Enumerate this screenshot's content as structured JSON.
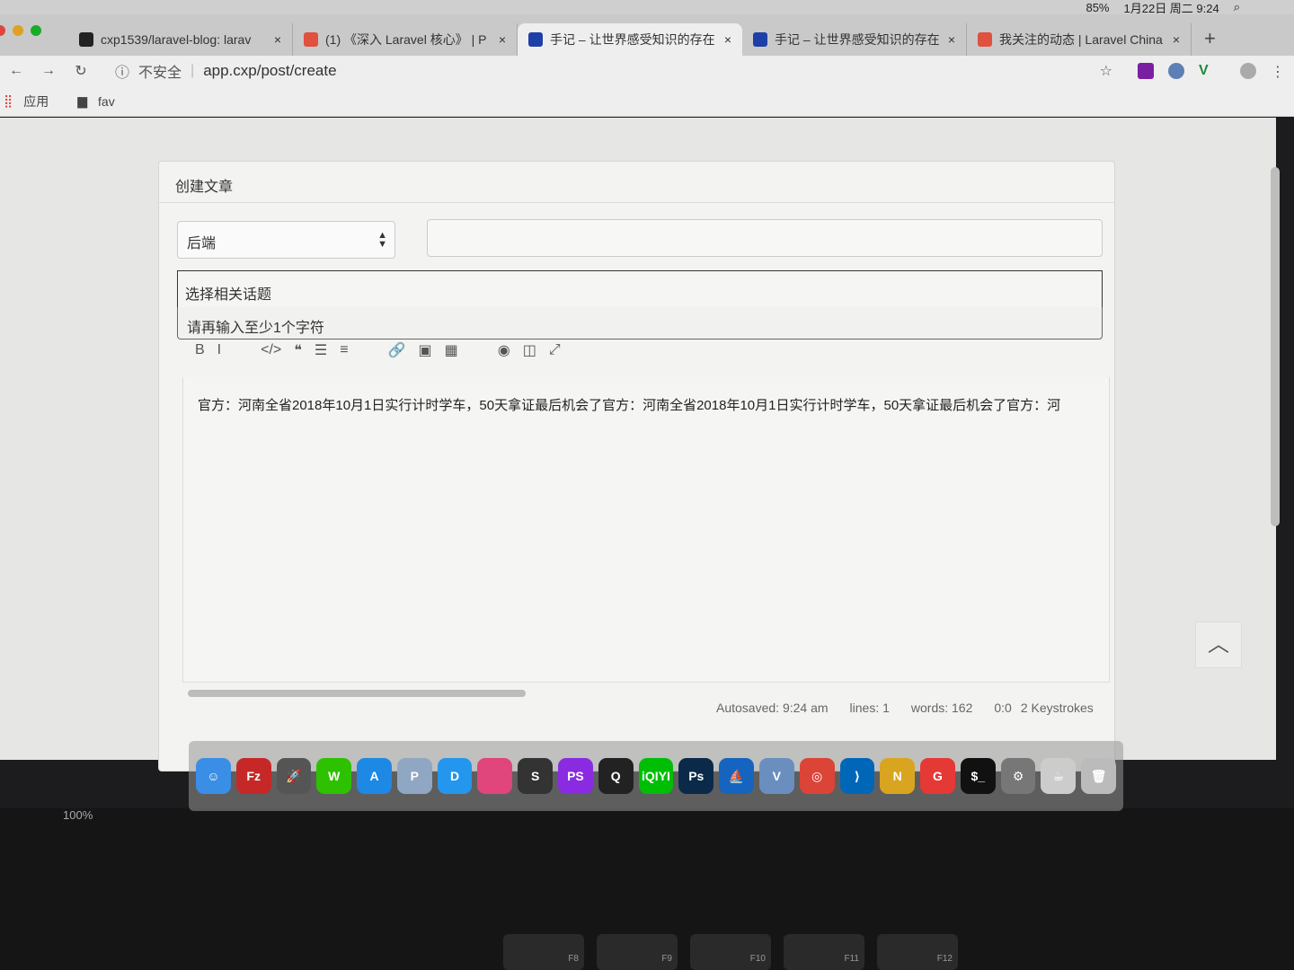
{
  "menubar": {
    "battery": "85%",
    "clock": "1月22日 周二 9:24"
  },
  "tabs": [
    {
      "title": "cxp1539/laravel-blog: larav",
      "icon": "github-icon",
      "color": "#222222"
    },
    {
      "title": "(1) 《深入 Laravel 核心》 | P",
      "icon": "laravel-icon",
      "color": "#e0513f"
    },
    {
      "title": "手记 – 让世界感受知识的存在",
      "icon": "notes-icon",
      "color": "#1e3fa8",
      "active": true
    },
    {
      "title": "手记 – 让世界感受知识的存在",
      "icon": "notes-icon",
      "color": "#1e3fa8"
    },
    {
      "title": "我关注的动态 | Laravel China",
      "icon": "laravel-icon",
      "color": "#e0513f"
    }
  ],
  "toolbar": {
    "security": "不安全",
    "url": "app.cxp/post/create"
  },
  "bookmarks": {
    "apps": "应用",
    "fav": "fav"
  },
  "card": {
    "title": "创建文章",
    "category": "后端",
    "title_input": "",
    "topic_placeholder": "选择相关话题",
    "topic_hint": "请再输入至少1个字符",
    "editor_tools": [
      "B",
      "I",
      "</>",
      "❝",
      "☰",
      "≡",
      "🔗",
      "▣",
      "▦",
      "◉",
      "◫",
      "⤢"
    ],
    "content": "官方：河南全省2018年10月1日实行计时学车，50天拿证最后机会了官方：河南全省2018年10月1日实行计时学车，50天拿证最后机会了官方：河",
    "status": {
      "autosaved": "Autosaved: 9:24 am",
      "lines": "lines: 1",
      "words": "words: 162",
      "cursor": "0:0",
      "keystrokes": "2 Keystrokes"
    }
  },
  "dock": [
    {
      "name": "finder",
      "label": "☺",
      "color": "#3a8ee6"
    },
    {
      "name": "filezilla",
      "label": "Fz",
      "color": "#c62828"
    },
    {
      "name": "launchpad",
      "label": "🚀",
      "color": "#555"
    },
    {
      "name": "wechat",
      "label": "W",
      "color": "#2dc100"
    },
    {
      "name": "app-store",
      "label": "A",
      "color": "#1e88e5"
    },
    {
      "name": "preview",
      "label": "P",
      "color": "#8fa7c2"
    },
    {
      "name": "docker",
      "label": "D",
      "color": "#2496ed"
    },
    {
      "name": "app-pink",
      "label": "",
      "color": "#e0457b"
    },
    {
      "name": "sublime",
      "label": "S",
      "color": "#333"
    },
    {
      "name": "phpstorm",
      "label": "PS",
      "color": "#8a2be2"
    },
    {
      "name": "qq",
      "label": "Q",
      "color": "#222"
    },
    {
      "name": "iqiyi",
      "label": "iQIYI",
      "color": "#00be06"
    },
    {
      "name": "photoshop",
      "label": "Ps",
      "color": "#0b2a4a"
    },
    {
      "name": "sequel",
      "label": "⛵",
      "color": "#1565c0"
    },
    {
      "name": "virtualbox",
      "label": "V",
      "color": "#6a8fbf"
    },
    {
      "name": "chrome",
      "label": "◎",
      "color": "#db4437"
    },
    {
      "name": "vscode",
      "label": "⟩",
      "color": "#0066b8"
    },
    {
      "name": "navicat",
      "label": "N",
      "color": "#d9a520"
    },
    {
      "name": "git-app",
      "label": "G",
      "color": "#e53935"
    },
    {
      "name": "terminal",
      "label": "$_",
      "color": "#111"
    },
    {
      "name": "system-preferences",
      "label": "⚙",
      "color": "#777"
    },
    {
      "name": "app-jar",
      "label": "☕",
      "color": "#ccc"
    },
    {
      "name": "trash",
      "label": "🗑",
      "color": "#bbb"
    }
  ],
  "screen": {
    "zoom": "100%"
  },
  "keys": [
    "F8",
    "F9",
    "F10",
    "F11",
    "F12"
  ]
}
